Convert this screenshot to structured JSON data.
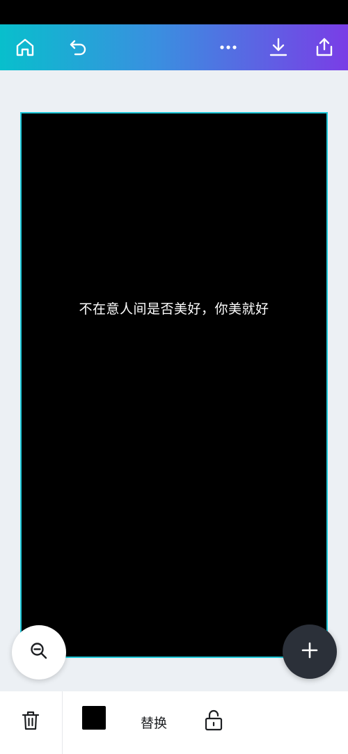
{
  "toolbar": {
    "buttons": [
      {
        "name": "home",
        "icon": "home-icon"
      },
      {
        "name": "undo",
        "icon": "undo-icon"
      },
      {
        "name": "more",
        "icon": "more-icon"
      },
      {
        "name": "download",
        "icon": "download-icon"
      },
      {
        "name": "share",
        "icon": "share-icon"
      }
    ],
    "gradient": [
      "#08bfcc",
      "#3a8fe0",
      "#7a3de6"
    ]
  },
  "canvas": {
    "text": "不在意人间是否美好，你美就好",
    "background_color": "#000000",
    "selection_color": "#1ec8d8"
  },
  "fabs": {
    "zoom_icon": "zoom-out-icon",
    "add_icon": "plus-icon"
  },
  "bottom_bar": {
    "delete_icon": "trash-icon",
    "color_swatch": "#000000",
    "replace_label": "替换",
    "lock_icon": "unlock-icon"
  }
}
